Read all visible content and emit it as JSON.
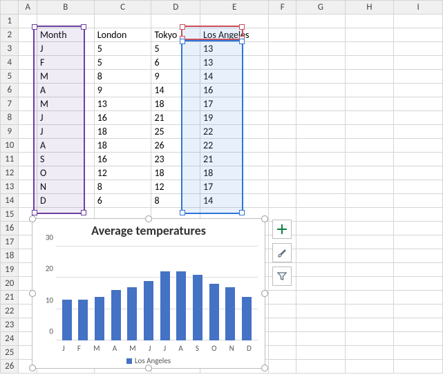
{
  "columns": [
    "A",
    "B",
    "C",
    "D",
    "E",
    "F",
    "G",
    "H",
    "I"
  ],
  "row_count": 26,
  "table": {
    "headers": {
      "month": "Month",
      "london": "London",
      "tokyo": "Tokyo",
      "la": "Los Angeles"
    },
    "rows": [
      {
        "m": "J",
        "london": "5",
        "tokyo": "5",
        "la": "13"
      },
      {
        "m": "F",
        "london": "5",
        "tokyo": "6",
        "la": "13"
      },
      {
        "m": "M",
        "london": "8",
        "tokyo": "9",
        "la": "14"
      },
      {
        "m": "A",
        "london": "9",
        "tokyo": "14",
        "la": "16"
      },
      {
        "m": "M",
        "london": "13",
        "tokyo": "18",
        "la": "17"
      },
      {
        "m": "J",
        "london": "16",
        "tokyo": "21",
        "la": "19"
      },
      {
        "m": "J",
        "london": "18",
        "tokyo": "25",
        "la": "22"
      },
      {
        "m": "A",
        "london": "18",
        "tokyo": "26",
        "la": "22"
      },
      {
        "m": "S",
        "london": "16",
        "tokyo": "23",
        "la": "21"
      },
      {
        "m": "O",
        "london": "12",
        "tokyo": "18",
        "la": "18"
      },
      {
        "m": "N",
        "london": "8",
        "tokyo": "12",
        "la": "17"
      },
      {
        "m": "D",
        "london": "6",
        "tokyo": "8",
        "la": "14"
      }
    ]
  },
  "chart": {
    "title": "Average temperatures",
    "legend": "Los Angeles",
    "yticks": [
      "0",
      "10",
      "20",
      "30"
    ]
  },
  "chart_data": {
    "type": "bar",
    "title": "Average temperatures",
    "categories": [
      "J",
      "F",
      "M",
      "A",
      "M",
      "J",
      "J",
      "A",
      "S",
      "O",
      "N",
      "D"
    ],
    "series": [
      {
        "name": "Los Angeles",
        "values": [
          13,
          13,
          14,
          16,
          17,
          19,
          22,
          22,
          21,
          18,
          17,
          14
        ]
      }
    ],
    "xlabel": "",
    "ylabel": "",
    "ylim": [
      0,
      30
    ],
    "yticks": [
      0,
      10,
      20,
      30
    ]
  }
}
